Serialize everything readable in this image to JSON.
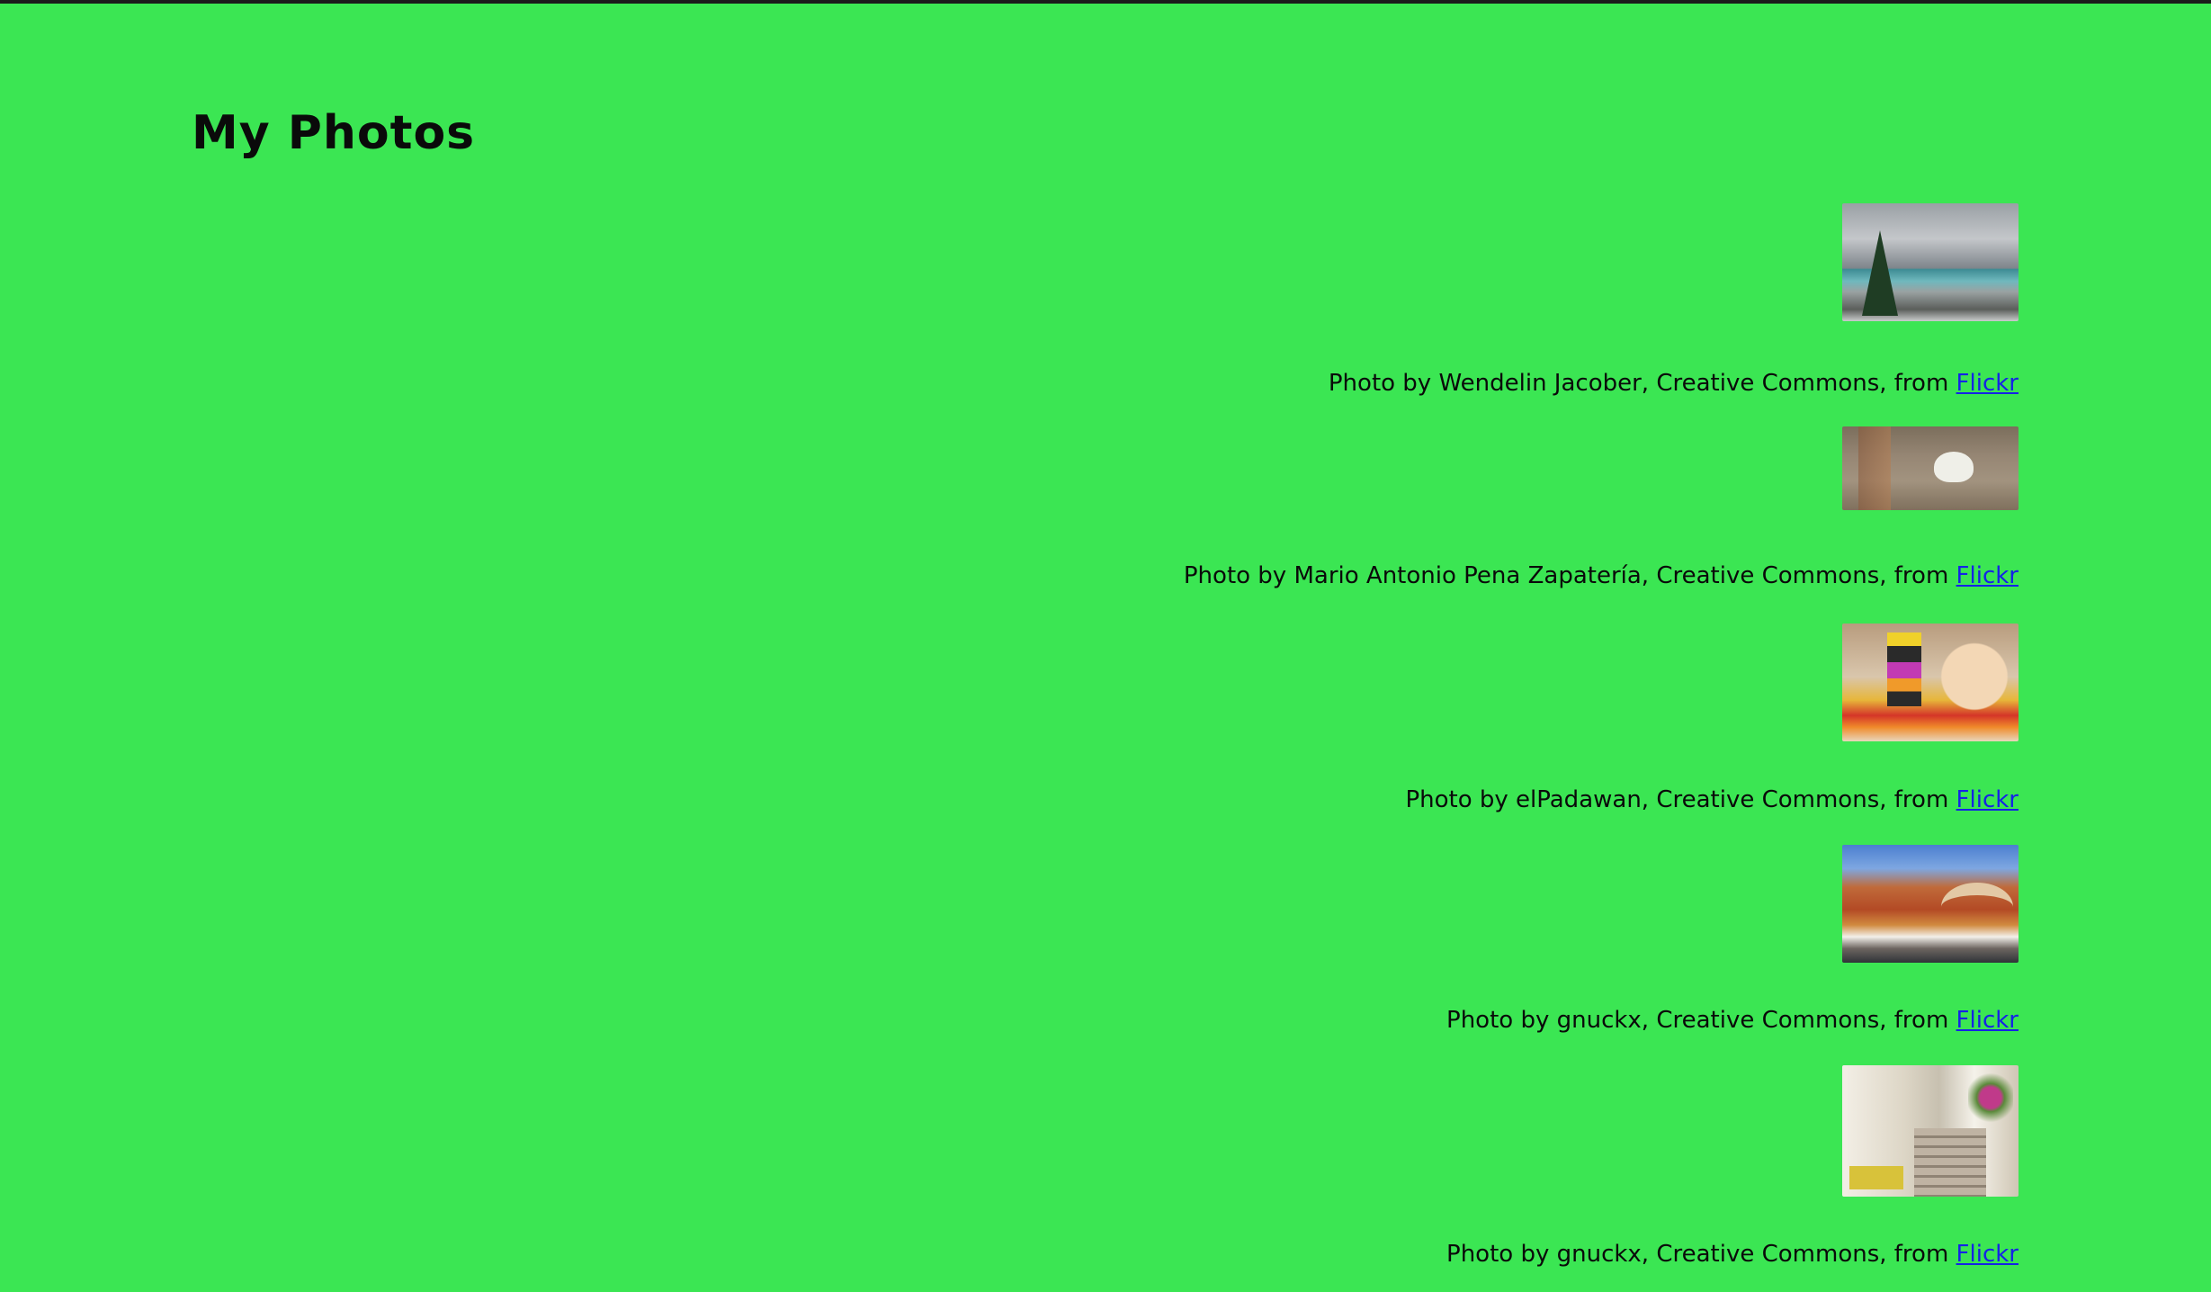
{
  "page": {
    "title": "My Photos",
    "background_color": "#3be653",
    "link_color": "#1523e6"
  },
  "photos": [
    {
      "subject": "snowy alpine lake with fir tree",
      "caption_prefix": "Photo by Wendelin Jacober, Creative Commons, from",
      "link_label": "Flickr"
    },
    {
      "subject": "white dog wading in water",
      "caption_prefix": "Photo by Mario Antonio Pena Zapatería, Creative Commons, from",
      "link_label": "Flickr"
    },
    {
      "subject": "child playing with colorful toy blocks",
      "caption_prefix": "Photo by elPadawan, Creative Commons, from",
      "link_label": "Flickr"
    },
    {
      "subject": "Venice canal with boats and bridge",
      "caption_prefix": "Photo by gnuckx, Creative Commons, from",
      "link_label": "Flickr"
    },
    {
      "subject": "narrow stone stairway street with flowers",
      "caption_prefix": "Photo by gnuckx, Creative Commons, from",
      "link_label": "Flickr"
    }
  ]
}
